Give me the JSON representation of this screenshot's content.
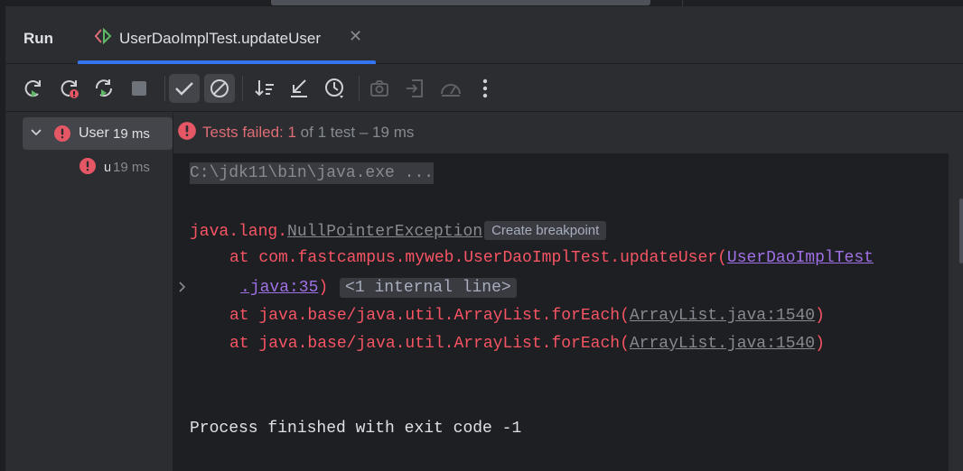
{
  "tool_window": {
    "title": "Run"
  },
  "tab": {
    "title": "UserDaoImplTest.updateUser",
    "close_glyph": "✕"
  },
  "toolbar": {
    "buttons": [
      {
        "name": "rerun-icon",
        "toggled": false
      },
      {
        "name": "rerun-failed-icon",
        "toggled": false
      },
      {
        "name": "toggle-auto-test-icon",
        "toggled": false
      },
      {
        "name": "stop-icon",
        "toggled": false
      },
      {
        "name": "show-passed-icon",
        "toggled": true
      },
      {
        "name": "show-ignored-icon",
        "toggled": true
      },
      {
        "name": "sort-icon",
        "toggled": false
      },
      {
        "name": "collapse-icon",
        "toggled": false
      },
      {
        "name": "history-icon",
        "toggled": false
      },
      {
        "name": "screenshot-icon",
        "toggled": false
      },
      {
        "name": "import-icon",
        "toggled": false
      },
      {
        "name": "coverage-icon",
        "toggled": false
      },
      {
        "name": "more-icon",
        "toggled": false
      }
    ]
  },
  "tree": {
    "root": {
      "name": "UserDaoImplTest",
      "time": "19 ms",
      "status": "failed"
    },
    "child": {
      "name": "updateUser",
      "time": "19 ms",
      "status": "failed"
    }
  },
  "status": {
    "failed_text": "Tests failed: 1",
    "rest_text": " of 1 test – 19 ms"
  },
  "console": {
    "command": "C:\\jdk11\\bin\\java.exe ...",
    "exception_prefix": "java.lang.",
    "exception_link": "NullPointerException",
    "breakpoint_chip": "Create breakpoint",
    "frame1_text": "at com.fastcampus.myweb.UserDaoImplTest.updateUser(",
    "frame1_link_a": "UserDaoImplTest",
    "frame1_link_b": ".java:35",
    "frame1_close": ")",
    "internal_chip": "<1 internal line>",
    "frame2_text": "at java.base/java.util.ArrayList.forEach(",
    "frame2_link": "ArrayList.java:1540",
    "frame2_close": ")",
    "frame3_text": "at java.base/java.util.ArrayList.forEach(",
    "frame3_link": "ArrayList.java:1540",
    "frame3_close": ")",
    "exit_message": "Process finished with exit code -1"
  },
  "colors": {
    "accent": "#3574f0",
    "error": "#f75464",
    "link": "#a070e6",
    "background": "#1e1f22",
    "panel": "#2b2d30"
  }
}
